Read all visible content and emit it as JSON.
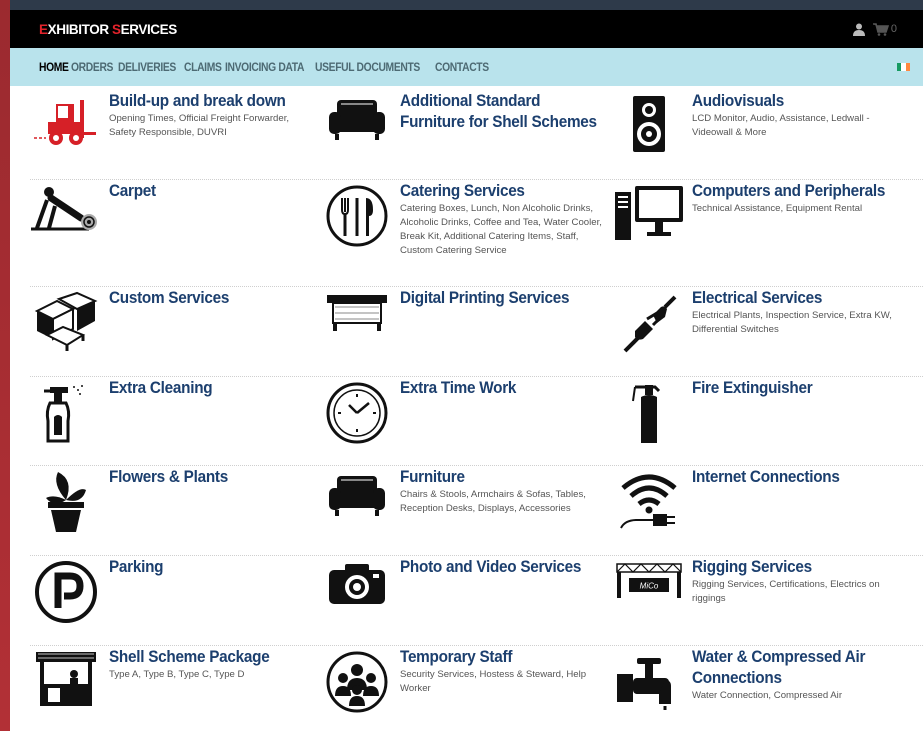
{
  "header": {
    "logo_first_letter": "E",
    "logo_first_word_rest": "XHIBITOR ",
    "logo_second_letter": "S",
    "logo_second_word_rest": "ERVICES",
    "cart_count": "0",
    "icons": [
      "user-icon",
      "cart-icon"
    ]
  },
  "nav": {
    "items": [
      {
        "label": "HOME",
        "active": true
      },
      {
        "label": "ORDERS"
      },
      {
        "label": "DELIVERIES"
      },
      {
        "label": "CLAIMS"
      },
      {
        "label": "INVOICING DATA"
      },
      {
        "label": "USEFUL DOCUMENTS"
      },
      {
        "label": "CONTACTS"
      }
    ],
    "flag_colors": [
      "#169b62",
      "#ffffff",
      "#ff883e"
    ]
  },
  "colors": {
    "title": "#1c3f6e",
    "accent_red": "#e3232b",
    "nav_bg": "#b9e3ec"
  },
  "services": [
    [
      {
        "title": "Build-up and break down",
        "desc": "Opening Times, Official Freight Forwarder, Safety Responsible, DUVRI",
        "icon": "forklift-icon"
      },
      {
        "title": "Additional Standard Furniture for Shell Schemes",
        "desc": "",
        "icon": "sofa-icon"
      },
      {
        "title": "Audiovisuals",
        "desc": "LCD Monitor, Audio, Assistance, Ledwall - Videowall & More",
        "icon": "speaker-icon"
      }
    ],
    [
      {
        "title": "Carpet",
        "desc": "",
        "icon": "carpet-roll-icon"
      },
      {
        "title": "Catering Services",
        "desc": "Catering Boxes, Lunch, Non Alcoholic Drinks, Alcoholic Drinks, Coffee and Tea, Water Cooler, Break Kit, Additional Catering Items, Staff, Custom Catering Service",
        "icon": "cutlery-icon"
      },
      {
        "title": "Computers and Peripherals",
        "desc": "Technical Assistance, Equipment Rental",
        "icon": "computer-icon"
      }
    ],
    [
      {
        "title": "Custom Services",
        "desc": "",
        "icon": "building-blocks-icon"
      },
      {
        "title": "Digital Printing Services",
        "desc": "",
        "icon": "printer-icon"
      },
      {
        "title": "Electrical Services",
        "desc": "Electrical Plants, Inspection Service, Extra KW, Differential Switches",
        "icon": "plug-icon"
      }
    ],
    [
      {
        "title": "Extra Cleaning",
        "desc": "",
        "icon": "spray-bottle-icon"
      },
      {
        "title": "Extra Time Work",
        "desc": "",
        "icon": "clock-icon"
      },
      {
        "title": "Fire Extinguisher",
        "desc": "",
        "icon": "fire-extinguisher-icon"
      }
    ],
    [
      {
        "title": "Flowers & Plants",
        "desc": "",
        "icon": "plant-pot-icon"
      },
      {
        "title": "Furniture",
        "desc": "Chairs & Stools, Armchairs & Sofas, Tables, Reception Desks, Displays, Accessories",
        "icon": "sofa-icon"
      },
      {
        "title": "Internet Connections",
        "desc": "",
        "icon": "wifi-icon"
      }
    ],
    [
      {
        "title": "Parking",
        "desc": "",
        "icon": "parking-icon"
      },
      {
        "title": "Photo and Video Services",
        "desc": "",
        "icon": "camera-icon"
      },
      {
        "title": "Rigging Services",
        "desc": "Rigging Services, Certifications, Electrics on riggings",
        "icon": "rigging-truss-icon",
        "icon_label": "MiCo"
      }
    ],
    [
      {
        "title": "Shell Scheme Package",
        "desc": "Type A, Type B, Type C, Type D",
        "icon": "booth-icon"
      },
      {
        "title": "Temporary Staff",
        "desc": "Security Services, Hostess & Steward, Help Worker",
        "icon": "people-group-icon"
      },
      {
        "title": "Water & Compressed Air Connections",
        "desc": "Water Connection, Compressed Air",
        "icon": "water-tap-icon"
      }
    ]
  ]
}
